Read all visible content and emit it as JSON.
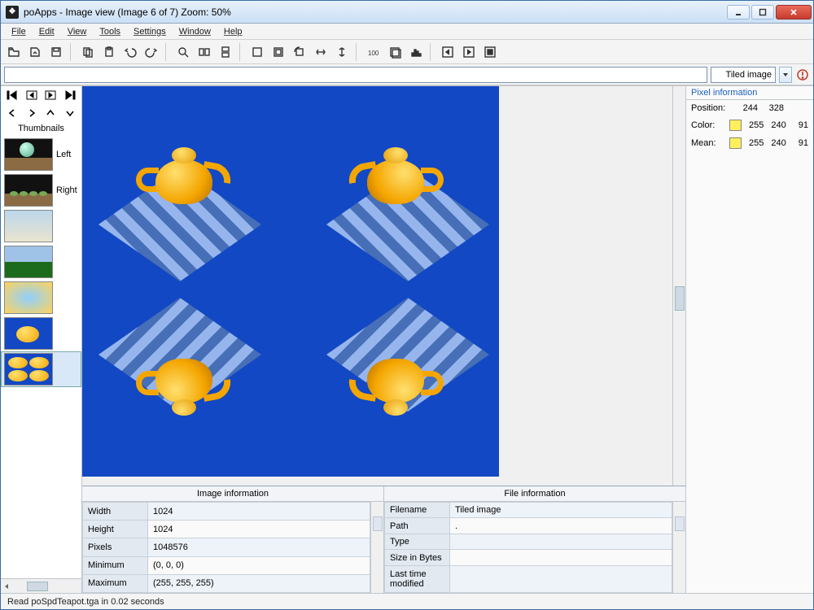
{
  "window": {
    "title": "poApps - Image view (Image 6 of 7) Zoom: 50%"
  },
  "menu": {
    "file": "File",
    "edit": "Edit",
    "view": "View",
    "tools": "Tools",
    "settings": "Settings",
    "window": "Window",
    "help": "Help"
  },
  "toolbar_icons": [
    "open",
    "recent",
    "save",
    "copy",
    "paste",
    "undo",
    "redo",
    "zoom-fit",
    "view-grid-h",
    "view-grid-v",
    "rect",
    "crop",
    "rotate",
    "flip-h",
    "flip-v",
    "counter",
    "layers",
    "histogram",
    "prev",
    "next",
    "stop"
  ],
  "searchbar": {
    "mode_value": "Tiled image"
  },
  "sidebar": {
    "thumbnails_title": "Thumbnails",
    "items": [
      {
        "label": "Left",
        "bg": "linear-gradient(#111 60%,#8a6b44 60%)",
        "extra": "sphere"
      },
      {
        "label": "Right",
        "bg": "linear-gradient(#111 60%,#8a6b44 60%)",
        "extra": "row"
      },
      {
        "label": "",
        "bg": "linear-gradient(#bcd7ec,#e9e4cf)"
      },
      {
        "label": "",
        "bg": "linear-gradient(#9fc3e6 50%,#1c6b1c 50%)"
      },
      {
        "label": "",
        "bg": "radial-gradient(#8fd0ff,#ffd35b)"
      },
      {
        "label": "",
        "bg": "#1248c3",
        "extra": "teapot"
      },
      {
        "label": "",
        "bg": "#1248c3",
        "selected": true,
        "extra": "teapots4"
      }
    ]
  },
  "pixel_info": {
    "header": "Pixel information",
    "position_label": "Position:",
    "position_x": "244",
    "position_y": "328",
    "color_label": "Color:",
    "color_r": "255",
    "color_g": "240",
    "color_b": "91",
    "mean_label": "Mean:",
    "mean_r": "255",
    "mean_g": "240",
    "mean_b": "91",
    "swatch": "#fff05b"
  },
  "image_info": {
    "title": "Image information",
    "rows": [
      {
        "k": "Width",
        "v": "1024"
      },
      {
        "k": "Height",
        "v": "1024"
      },
      {
        "k": "Pixels",
        "v": "1048576"
      },
      {
        "k": "Minimum",
        "v": "(0, 0, 0)"
      },
      {
        "k": "Maximum",
        "v": "(255, 255, 255)"
      }
    ]
  },
  "file_info": {
    "title": "File information",
    "rows": [
      {
        "k": "Filename",
        "v": "Tiled image"
      },
      {
        "k": "Path",
        "v": "."
      },
      {
        "k": "Type",
        "v": ""
      },
      {
        "k": "Size in Bytes",
        "v": ""
      },
      {
        "k": "Last time modified",
        "v": ""
      }
    ]
  },
  "status": {
    "text": "Read poSpdTeapot.tga in 0.02 seconds"
  }
}
